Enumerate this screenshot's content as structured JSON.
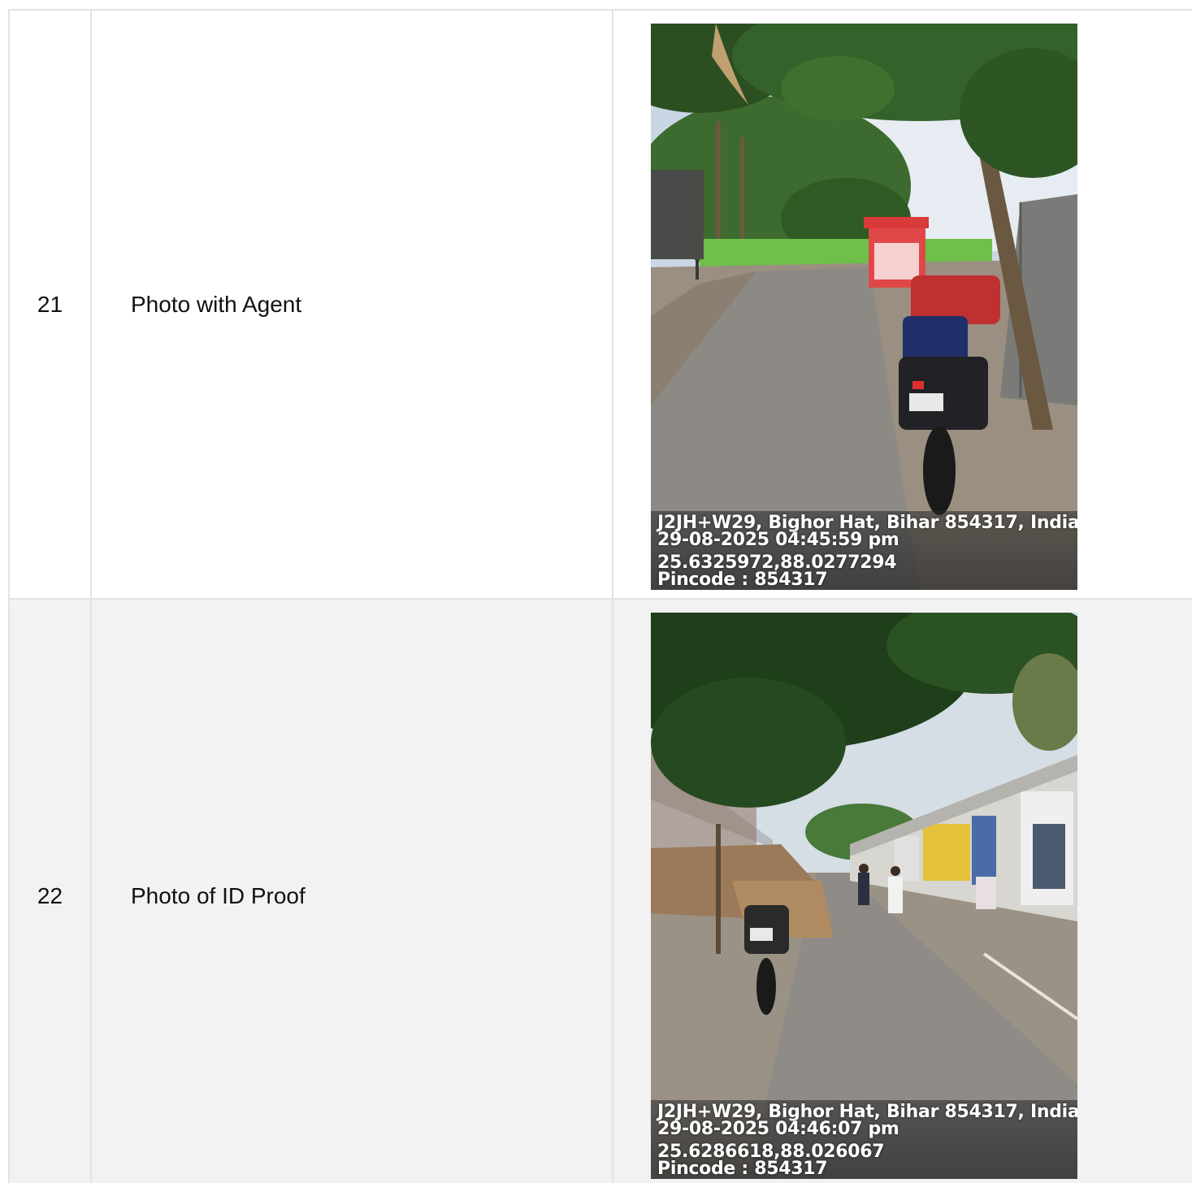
{
  "rows": [
    {
      "number": "21",
      "label": "Photo with Agent",
      "photo": {
        "address": "J2JH+W29, Bighor Hat, Bihar 854317, India .",
        "timestamp": "29-08-2025 04:45:59 pm",
        "coordinates": "25.6325972,88.0277294",
        "pincode": "Pincode : 854317"
      }
    },
    {
      "number": "22",
      "label": "Photo of ID Proof",
      "photo": {
        "address": "J2JH+W29, Bighor Hat, Bihar 854317, India .",
        "timestamp": "29-08-2025 04:46:07 pm",
        "coordinates": "25.6286618,88.026067",
        "pincode": "Pincode : 854317"
      }
    }
  ]
}
